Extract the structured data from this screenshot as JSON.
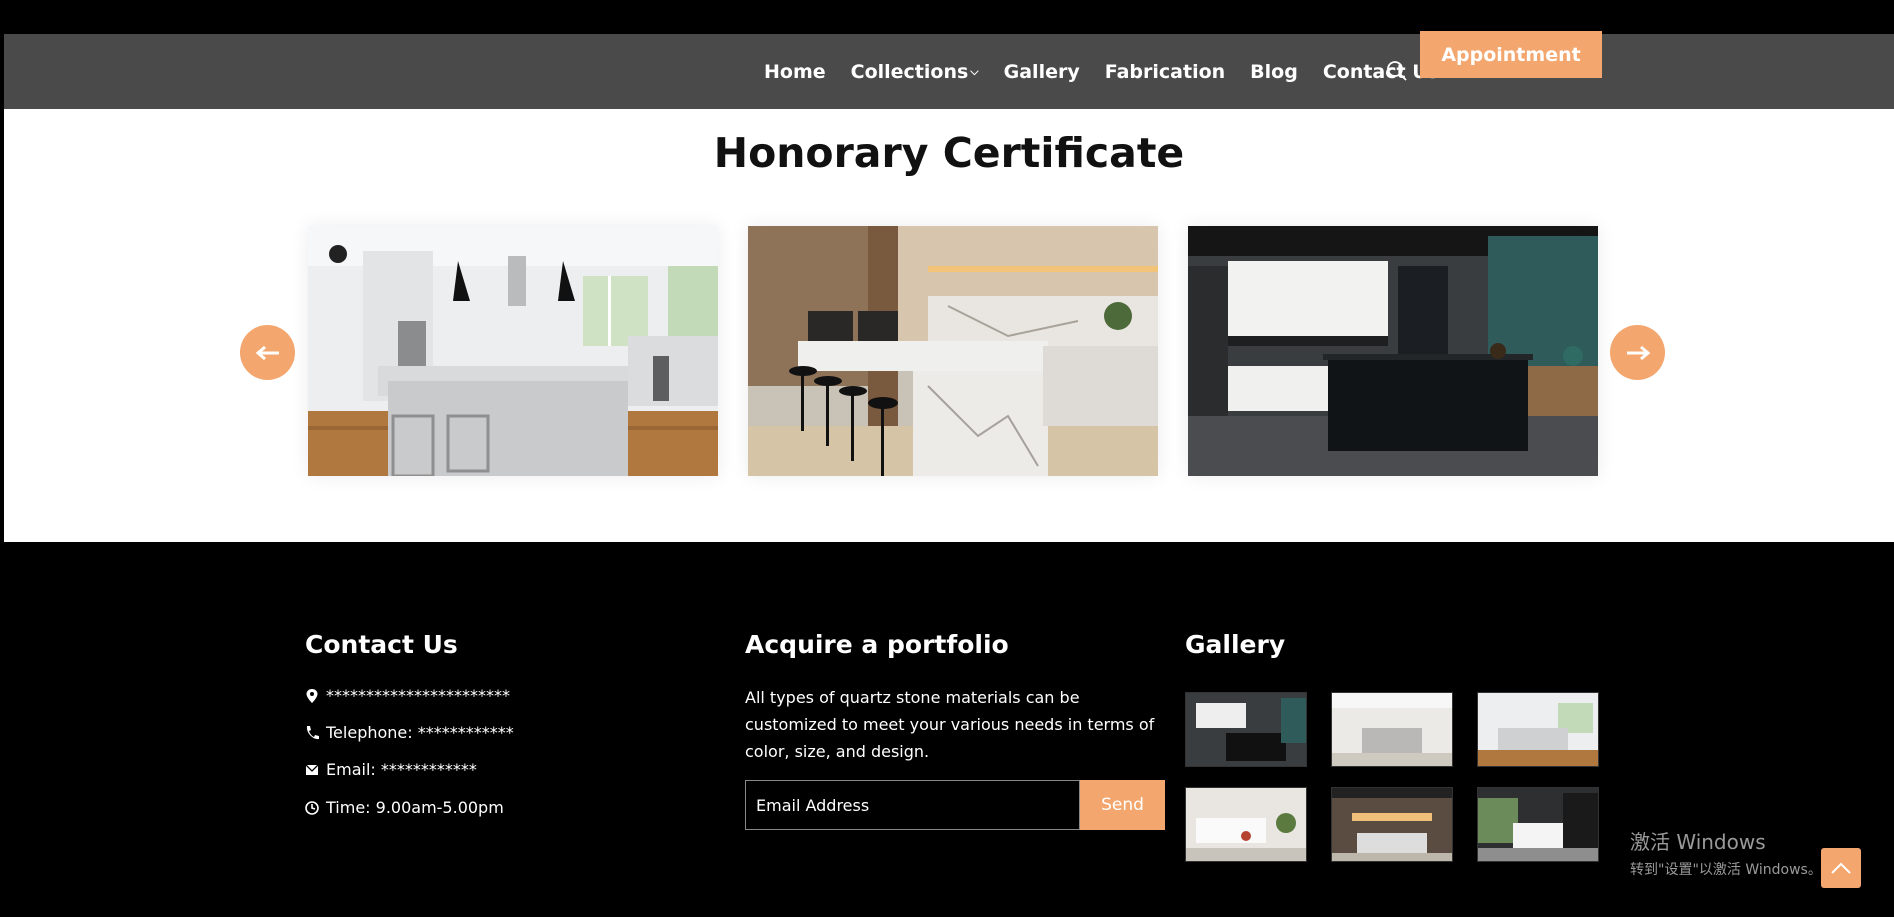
{
  "nav": {
    "items": [
      {
        "label": "Home",
        "dropdown": false
      },
      {
        "label": "Collections",
        "dropdown": true
      },
      {
        "label": "Gallery",
        "dropdown": false
      },
      {
        "label": "Fabrication",
        "dropdown": false
      },
      {
        "label": "Blog",
        "dropdown": false
      },
      {
        "label": "Contact Us",
        "dropdown": true
      }
    ],
    "search_icon": "search-icon",
    "appointment_label": "Appointment"
  },
  "section": {
    "title": "Honorary Certificate",
    "prev_icon": "arrow-left-icon",
    "next_icon": "arrow-right-icon",
    "slides": [
      "white-kitchen-image",
      "marble-island-kitchen-image",
      "dark-showroom-kitchen-image"
    ]
  },
  "footer": {
    "contact": {
      "title": "Contact Us",
      "address": "***********************",
      "telephone": "Telephone: ************",
      "email": "Email: ************",
      "time": "Time: 9.00am-5.00pm"
    },
    "portfolio": {
      "title": "Acquire a portfolio",
      "text": "All types of quartz stone materials can be customized to meet your various needs in terms of color, size, and design.",
      "email_placeholder": "Email Address",
      "send_label": "Send"
    },
    "gallery": {
      "title": "Gallery",
      "thumbnails": 6
    }
  },
  "watermark": {
    "line1": "激活 Windows",
    "line2": "转到\"设置\"以激活 Windows。"
  },
  "colors": {
    "accent": "#f3a66e",
    "header_bg": "#4a4a4a",
    "footer_bg": "#000000"
  }
}
